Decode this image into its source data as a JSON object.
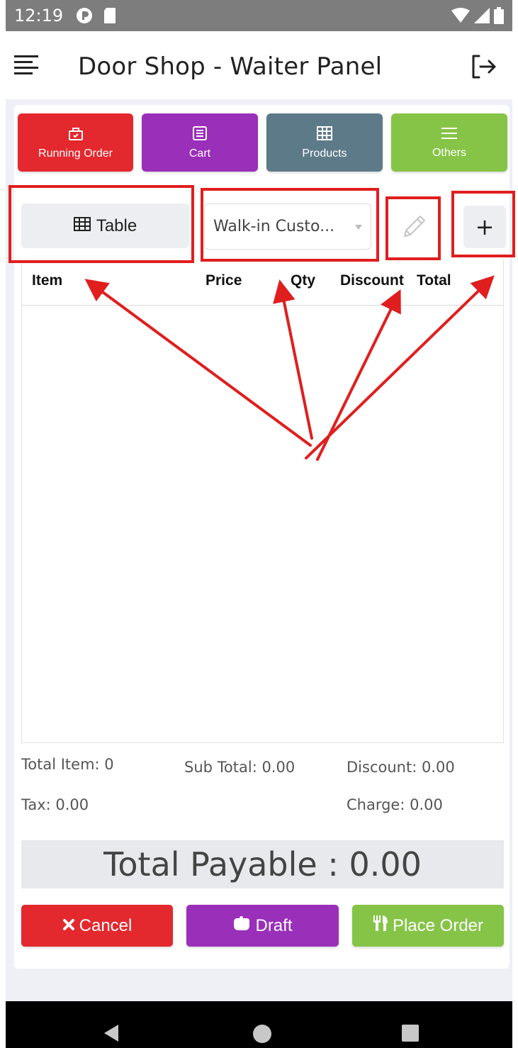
{
  "status_bar": {
    "time": "12:19"
  },
  "app_bar": {
    "title": "Door Shop - Waiter Panel"
  },
  "top_actions": [
    {
      "label": "Running Order",
      "icon": "bag-icon"
    },
    {
      "label": "Cart",
      "icon": "list-icon"
    },
    {
      "label": "Products",
      "icon": "grid-icon"
    },
    {
      "label": "Others",
      "icon": "menu-icon"
    }
  ],
  "table_button": {
    "label": "Table"
  },
  "customer_select": {
    "value": "Walk-in Custo..."
  },
  "add_button": {
    "label": "+"
  },
  "items_table": {
    "columns": [
      "Item",
      "Price",
      "Qty",
      "Discount",
      "Total"
    ],
    "rows": []
  },
  "summary": {
    "total_item": "Total Item: 0",
    "sub_total": "Sub Total: 0.00",
    "discount": "Discount: 0.00",
    "tax": "Tax: 0.00",
    "charge": "Charge: 0.00"
  },
  "total_payable": "Total Payable : 0.00",
  "bottom_actions": {
    "cancel": "Cancel",
    "draft": "Draft",
    "place_order": "Place Order"
  },
  "colors": {
    "red": "#e3282e",
    "purple": "#9a2fb9",
    "slate": "#5d7a89",
    "green": "#86c447",
    "annotation_red": "#e01e1e"
  }
}
